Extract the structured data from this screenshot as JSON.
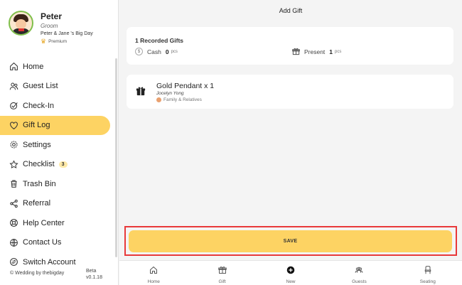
{
  "profile": {
    "name": "Peter",
    "role": "Groom",
    "event": "Peter & Jane 's Big Day",
    "plan": "Premium"
  },
  "nav": {
    "home": "Home",
    "guest_list": "Guest List",
    "check_in": "Check-In",
    "gift_log": "Gift Log",
    "settings": "Settings",
    "checklist": "Checklist",
    "checklist_badge": "3",
    "trash_bin": "Trash Bin",
    "referral": "Referral",
    "help_center": "Help Center",
    "contact_us": "Contact Us",
    "switch_account": "Switch Account",
    "active": "gift_log"
  },
  "footer": {
    "brand": "© Wedding by thebigday",
    "beta": "Beta",
    "version": "v0.1.18"
  },
  "header": {
    "title": "Add Gift"
  },
  "summary": {
    "title": "1 Recorded Gifts",
    "cash_label": "Cash",
    "cash_count": "0",
    "present_label": "Present",
    "present_count": "1",
    "unit": "pcs"
  },
  "gift": {
    "name": "Gold Pendant x 1",
    "giver": "Jocelyn Yong",
    "group": "Family & Relatives"
  },
  "save_label": "SAVE",
  "tabs": {
    "home": "Home",
    "gift": "Gift",
    "new": "New",
    "guests": "Guests",
    "seating": "Seating"
  },
  "colors": {
    "accent": "#fdd363",
    "highlight": "#e8393a"
  }
}
